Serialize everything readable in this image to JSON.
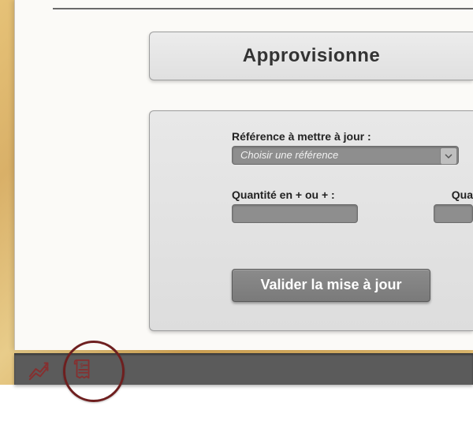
{
  "title": "Approvisionne",
  "form": {
    "reference": {
      "label": "Référence à mettre à jour :",
      "placeholder": "Choisir une référence"
    },
    "quantity_delta": {
      "label": "Quantité en + ou + :",
      "value": ""
    },
    "quantity_right": {
      "label": "Qua",
      "value": ""
    },
    "submit_label": "Valider la mise à jour"
  },
  "taskbar": {
    "icons": [
      "chart-icon",
      "invoice-icon"
    ]
  },
  "colors": {
    "icon": "#8a2c2c",
    "circle": "#6e1f1f"
  }
}
